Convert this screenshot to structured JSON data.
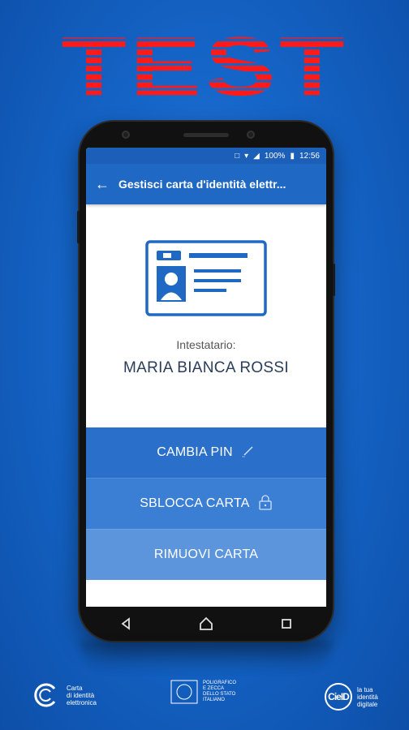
{
  "banner": {
    "text": "TEST"
  },
  "status_bar": {
    "battery": "100%",
    "time": "12:56"
  },
  "app_bar": {
    "title": "Gestisci carta d'identità elettr...",
    "back_icon": "arrow-left-icon"
  },
  "card": {
    "icon": "id-card-icon",
    "holder_label": "Intestatario:",
    "holder_name": "MARIA BIANCA ROSSI"
  },
  "actions": [
    {
      "label": "CAMBIA PIN",
      "icon": "pencil-icon"
    },
    {
      "label": "SBLOCCA CARTA",
      "icon": "lock-icon"
    },
    {
      "label": "RIMUOVI CARTA",
      "icon": ""
    }
  ],
  "nav_bar": {
    "back": "back-triangle-icon",
    "home": "home-icon",
    "recents": "recents-square-icon"
  },
  "footer": {
    "cie_lines": [
      "Carta",
      "di identità",
      "elettronica"
    ],
    "ipzs_lines": [
      "POLIGRAFICO",
      "E ZECCA",
      "DELLO STATO",
      "ITALIANO"
    ],
    "cieid_logo": "CieID",
    "cieid_lines": [
      "la tua",
      "identità",
      "digitale"
    ]
  },
  "colors": {
    "background": "#1565c8",
    "banner": "#ff1a1a",
    "app_bar": "#1f68c4",
    "action_1": "#2a6fc9",
    "action_2": "#3b7fd4",
    "action_3": "#5d95dc",
    "holder_name": "#2a3d5a"
  }
}
